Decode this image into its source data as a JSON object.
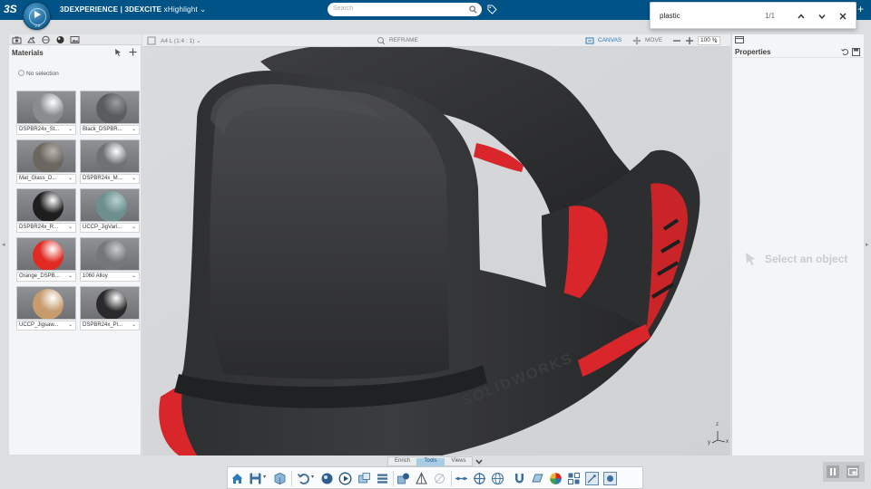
{
  "app": {
    "brand_prefix": "3DEXPERIENCE | 3DEXCITE",
    "app_name": "xHighlight",
    "compass_version": "V.R"
  },
  "search": {
    "placeholder": "Search"
  },
  "find": {
    "query": "plastic",
    "count": "1/1"
  },
  "left_panel": {
    "title": "Materials",
    "selection_text": "No selection",
    "materials": [
      {
        "label": "DSPBR24x_St...",
        "color": "#8a8d90",
        "highlight": "#ffffff",
        "metal": true
      },
      {
        "label": "Black_DSPBR...",
        "color": "#5a5c5e",
        "highlight": "#9a9c9e",
        "metal": false
      },
      {
        "label": "Mat_Glass_D...",
        "color": "#6b6660",
        "highlight": "#b9b4ae",
        "metal": false
      },
      {
        "label": "DSPBR24x_M...",
        "color": "#6f7275",
        "highlight": "#ffffff",
        "metal": true
      },
      {
        "label": "DSPBR24x_R...",
        "color": "#1e1e1f",
        "highlight": "#ffffff",
        "metal": false
      },
      {
        "label": "UCCP_JigVari...",
        "color": "#6d8f8e",
        "highlight": "#b8d1cf",
        "metal": false
      },
      {
        "label": "Orange_DSPB...",
        "color": "#e02a22",
        "highlight": "#ffffff",
        "metal": false
      },
      {
        "label": "1060 Alloy",
        "color": "#747678",
        "highlight": "#c9cbcd",
        "metal": false
      },
      {
        "label": "UCCP_Jigsaw...",
        "color": "#c69c6d",
        "highlight": "#ffffff",
        "metal": false
      },
      {
        "label": "DSPBR24x_Pl...",
        "color": "#2a2a2b",
        "highlight": "#ffffff",
        "metal": false
      }
    ]
  },
  "viewport": {
    "sheet": "A4 L (1:4 : 1)",
    "reframe": "REFRAME",
    "canvas": "CANVAS",
    "move": "MOVE",
    "zoom": "100 %",
    "model_text": "SOLIDWORKS",
    "axis_z": "z",
    "axis_x": "x",
    "axis_y": "y"
  },
  "right_panel": {
    "title": "Properties",
    "placeholder": "Select an object"
  },
  "dock": {
    "tabs": [
      "Enrich",
      "Tools",
      "Views"
    ],
    "active_tab": "Tools"
  },
  "colors": {
    "topbar": "#005386",
    "accent": "#2c7ab5",
    "model_dark": "#2b2c2e",
    "model_red": "#d8262a"
  }
}
